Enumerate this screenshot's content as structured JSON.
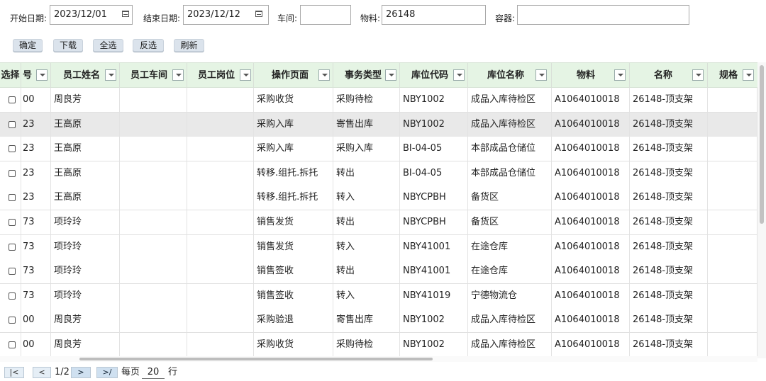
{
  "filters": {
    "start_date_label": "开始日期:",
    "start_date_value": "2023/12/01",
    "end_date_label": "结束日期:",
    "end_date_value": "2023/12/12",
    "workshop_label": "车间:",
    "workshop_value": "",
    "material_label": "物料:",
    "material_value": "26148",
    "container_label": "容器:",
    "container_value": ""
  },
  "toolbar": {
    "confirm": "确定",
    "download": "下载",
    "select_all": "全选",
    "invert": "反选",
    "refresh": "刷新"
  },
  "columns": [
    "选择",
    "号",
    "员工姓名",
    "员工车间",
    "员工岗位",
    "操作页面",
    "事务类型",
    "库位代码",
    "库位名称",
    "物料",
    "名称",
    "规格"
  ],
  "rows": [
    {
      "num": "00",
      "name": "周良芳",
      "workshop": "",
      "post": "",
      "page": "采购收货",
      "type": "采购待检",
      "loc_code": "NBY1002",
      "loc_name": "成品入库待检区",
      "material": "A1064010018",
      "desc": "26148-顶支架",
      "spec": ""
    },
    {
      "num": "23",
      "name": "王高原",
      "workshop": "",
      "post": "",
      "page": "采购入库",
      "type": "寄售出库",
      "loc_code": "NBY1002",
      "loc_name": "成品入库待检区",
      "material": "A1064010018",
      "desc": "26148-顶支架",
      "spec": ""
    },
    {
      "num": "23",
      "name": "王高原",
      "workshop": "",
      "post": "",
      "page": "采购入库",
      "type": "采购入库",
      "loc_code": "BI-04-05",
      "loc_name": "本部成品仓储位",
      "material": "A1064010018",
      "desc": "26148-顶支架",
      "spec": ""
    },
    {
      "num": "23",
      "name": "王高原",
      "workshop": "",
      "post": "",
      "page": "转移.组托.拆托",
      "type": "转出",
      "loc_code": "BI-04-05",
      "loc_name": "本部成品仓储位",
      "material": "A1064010018",
      "desc": "26148-顶支架",
      "spec": ""
    },
    {
      "num": "23",
      "name": "王高原",
      "workshop": "",
      "post": "",
      "page": "转移.组托.拆托",
      "type": "转入",
      "loc_code": "NBYCPBH",
      "loc_name": "备货区",
      "material": "A1064010018",
      "desc": "26148-顶支架",
      "spec": ""
    },
    {
      "num": "73",
      "name": "项玲玲",
      "workshop": "",
      "post": "",
      "page": "销售发货",
      "type": "转出",
      "loc_code": "NBYCPBH",
      "loc_name": "备货区",
      "material": "A1064010018",
      "desc": "26148-顶支架",
      "spec": ""
    },
    {
      "num": "73",
      "name": "项玲玲",
      "workshop": "",
      "post": "",
      "page": "销售发货",
      "type": "转入",
      "loc_code": "NBY41001",
      "loc_name": "在途仓库",
      "material": "A1064010018",
      "desc": "26148-顶支架",
      "spec": ""
    },
    {
      "num": "73",
      "name": "项玲玲",
      "workshop": "",
      "post": "",
      "page": "销售签收",
      "type": "转出",
      "loc_code": "NBY41001",
      "loc_name": "在途仓库",
      "material": "A1064010018",
      "desc": "26148-顶支架",
      "spec": ""
    },
    {
      "num": "73",
      "name": "项玲玲",
      "workshop": "",
      "post": "",
      "page": "销售签收",
      "type": "转入",
      "loc_code": "NBY41019",
      "loc_name": "宁德物流仓",
      "material": "A1064010018",
      "desc": "26148-顶支架",
      "spec": ""
    },
    {
      "num": "00",
      "name": "周良芳",
      "workshop": "",
      "post": "",
      "page": "采购验退",
      "type": "寄售出库",
      "loc_code": "NBY1002",
      "loc_name": "成品入库待检区",
      "material": "A1064010018",
      "desc": "26148-顶支架",
      "spec": ""
    },
    {
      "num": "00",
      "name": "周良芳",
      "workshop": "",
      "post": "",
      "page": "采购收货",
      "type": "采购待检",
      "loc_code": "NBY1002",
      "loc_name": "成品入库待检区",
      "material": "A1064010018",
      "desc": "26148-顶支架",
      "spec": ""
    }
  ],
  "pager": {
    "first": "|<",
    "prev": "<",
    "page_indicator": "1/2",
    "next": ">",
    "last": ">/",
    "per_page_label": "每页",
    "per_page_value": "20",
    "rows_label": "行"
  },
  "icons": {
    "calendar": "calendar-icon",
    "dropdown": "chevron-down-icon",
    "checkbox": "checkbox"
  },
  "colors": {
    "header_bg": "#e5f4e4",
    "selected_row_bg": "#e9e9e9",
    "button_bg": "#dbe3ec"
  }
}
